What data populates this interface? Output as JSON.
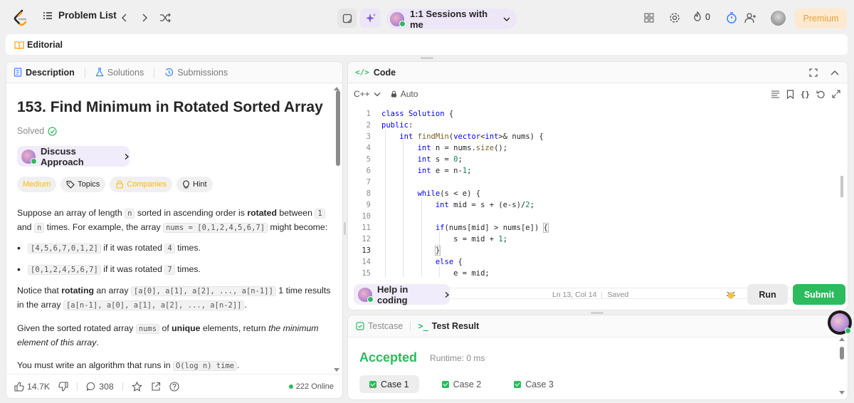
{
  "nav": {
    "problem_list": "Problem List",
    "session": "1:1 Sessions with me",
    "streak_count": "0",
    "premium": "Premium"
  },
  "editorial": "Editorial",
  "left_tabs": {
    "description": "Description",
    "solutions": "Solutions",
    "submissions": "Submissions"
  },
  "problem": {
    "title": "153. Find Minimum in Rotated Sorted Array",
    "solved": "Solved",
    "discuss": "Discuss Approach",
    "chips": {
      "difficulty": "Medium",
      "topics": "Topics",
      "companies": "Companies",
      "hint": "Hint"
    }
  },
  "stats": {
    "likes": "14.7K",
    "comments": "308",
    "online": "222 Online"
  },
  "code_panel": {
    "title": "Code",
    "language": "C++",
    "mode": "Auto",
    "lines": [
      "1",
      "2",
      "3",
      "4",
      "5",
      "6",
      "7",
      "8",
      "9",
      "10",
      "11",
      "12",
      "13",
      "14",
      "15"
    ],
    "help": "Help in coding",
    "cursor": "Ln 13, Col 14",
    "saved": "Saved",
    "run": "Run",
    "submit": "Submit"
  },
  "test_panel": {
    "testcase": "Testcase",
    "result": "Test Result",
    "status": "Accepted",
    "runtime": "Runtime: 0 ms",
    "cases": [
      "Case 1",
      "Case 2",
      "Case 3"
    ]
  },
  "colors": {
    "accent_green": "#2cbb5d",
    "medium": "#ffb800",
    "premium": "#e8a23a"
  }
}
